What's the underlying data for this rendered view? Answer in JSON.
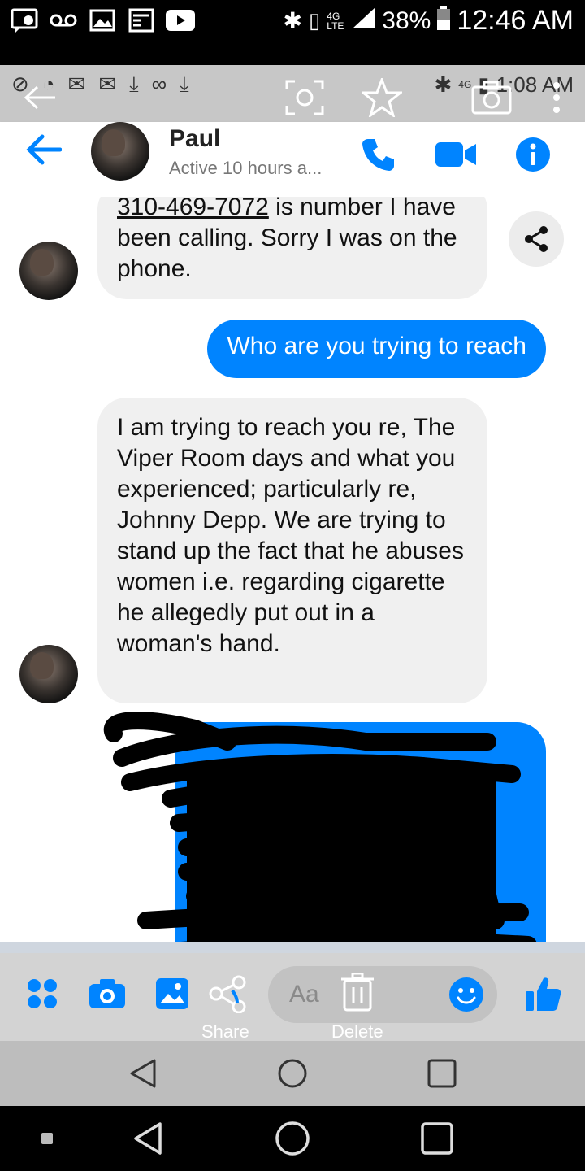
{
  "status_bar": {
    "battery": "38%",
    "time": "12:46 AM",
    "network": "4G LTE"
  },
  "inner_status_bar": {
    "network": "4G",
    "time": "1:08 AM"
  },
  "header": {
    "contact_name": "Paul",
    "active_status": "Active 10 hours a...",
    "accent_color": "#0084ff"
  },
  "messages": [
    {
      "direction": "incoming",
      "phone": "310-469-7072",
      "text": " is number I have been calling. Sorry I was on the phone."
    },
    {
      "direction": "outgoing",
      "text": "Who are you trying to reach"
    },
    {
      "direction": "incoming",
      "text": "I am trying to reach you re, The Viper Room days and what you experienced; particularly re, Johnny Depp. We are trying to stand up the fact that he abuses women i.e. regarding cigarette he allegedly put out in a woman's hand."
    },
    {
      "direction": "outgoing",
      "text": "",
      "redacted": true
    }
  ],
  "composer": {
    "placeholder": "Aa",
    "share_label": "Share",
    "delete_label": "Delete"
  },
  "icons": {
    "back": "arrow-left-icon",
    "call": "phone-icon",
    "video": "video-camera-icon",
    "info": "info-icon",
    "share": "share-icon",
    "apps": "apps-grid-icon",
    "camera": "camera-icon",
    "gallery": "image-icon",
    "emoji": "smiley-icon",
    "like": "thumbs-up-icon"
  }
}
